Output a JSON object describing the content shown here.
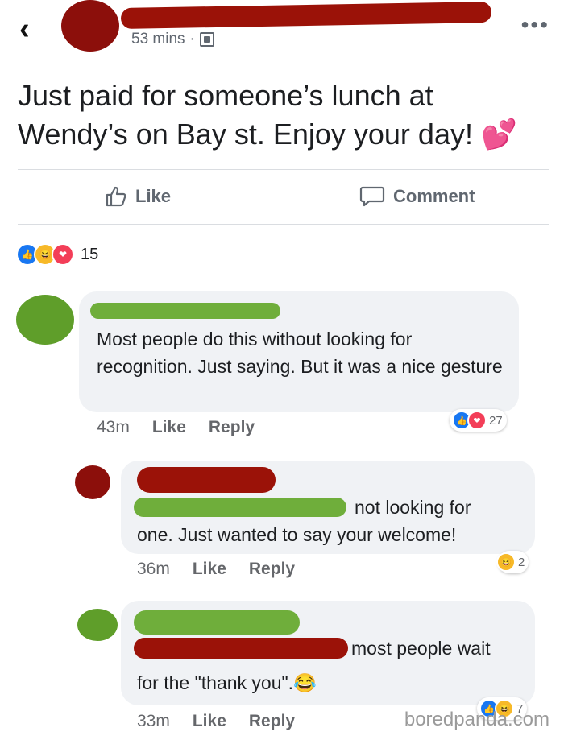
{
  "header": {
    "back_icon": "chevron-left-icon",
    "time": "53 mins",
    "separator": "·",
    "privacy_icon": "friends-icon",
    "more_icon": "ellipsis-icon"
  },
  "post": {
    "text": "Just paid for someone’s lunch at Wendy’s on Bay st. Enjoy your day! 💕"
  },
  "actions": {
    "like_label": "Like",
    "comment_label": "Comment"
  },
  "reactions": {
    "count": "15"
  },
  "comments": [
    {
      "text": "Most people do this without looking for recognition. Just saying. But it was a nice gesture",
      "time": "43m",
      "like": "Like",
      "reply": "Reply",
      "reaction_count": "27"
    },
    {
      "text_visible": "not looking for",
      "text_line2": "one. Just wanted to say your welcome!",
      "time": "36m",
      "like": "Like",
      "reply": "Reply",
      "reaction_count": "2"
    },
    {
      "text_visible": "most people wait",
      "text_line2": "for the \"thank you\".😂",
      "time": "33m",
      "like": "Like",
      "reply": "Reply",
      "reaction_count": "7"
    }
  ],
  "watermark": "boredpanda.com"
}
